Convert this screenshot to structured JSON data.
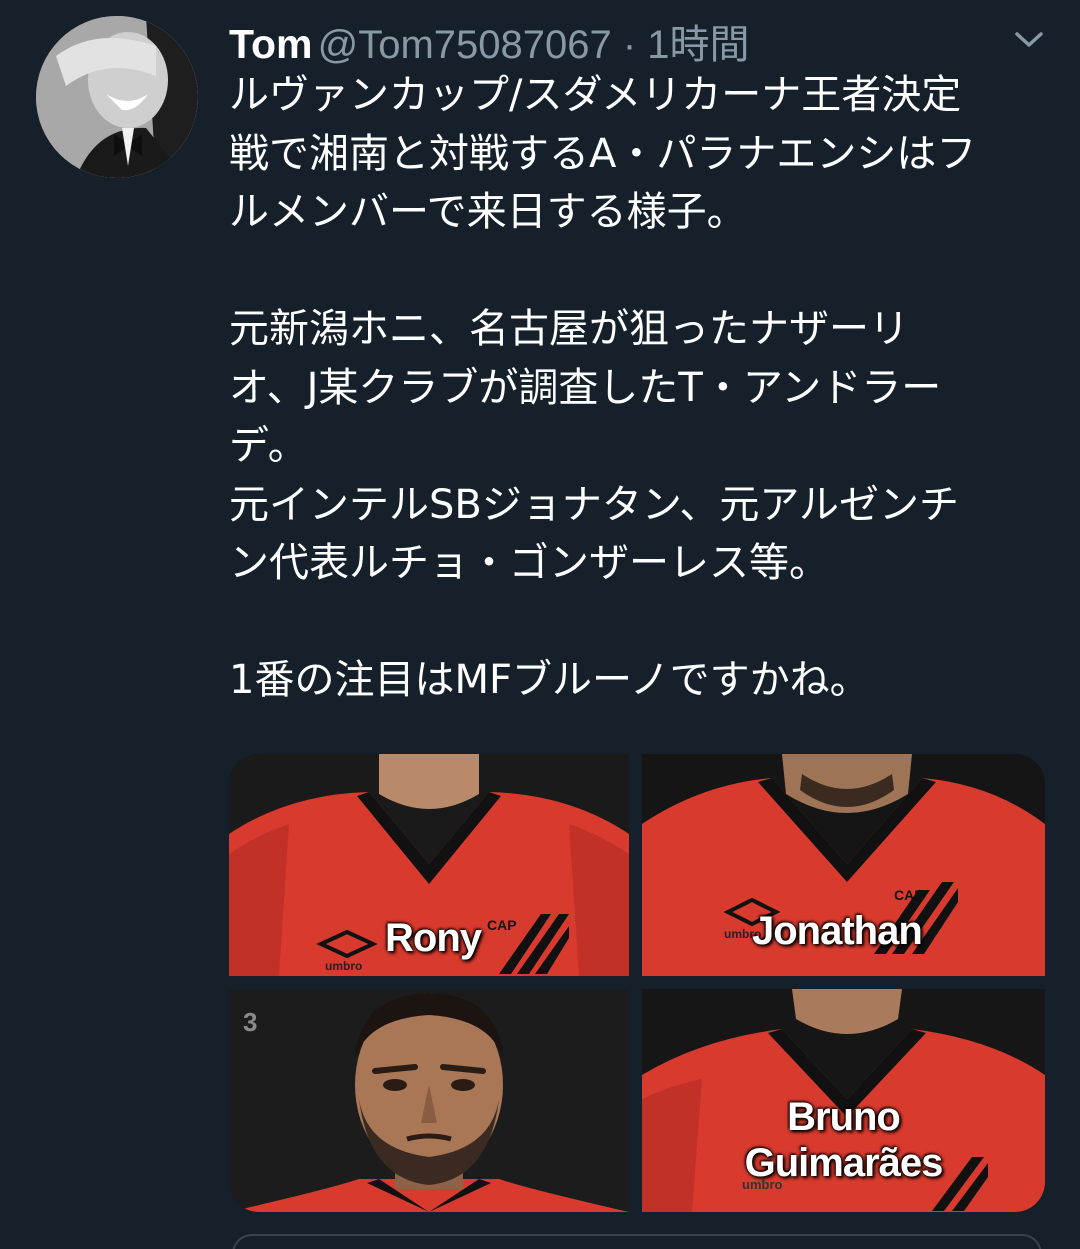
{
  "user": {
    "name": "Tom",
    "handle": "@Tom75087067",
    "separator": "·",
    "time": "1時間",
    "avatar": "avatar-man-bowtie"
  },
  "tweet": {
    "lines": [
      "ルヴァンカップ/スダメリカーナ王者決定",
      "戦で湘南と対戦するA・パラナエンシはフ",
      "ルメンバーで来日する様子。",
      "",
      "元新潟ホニ、名古屋が狙ったナザーリ",
      "オ、J某クラブが調査したT・アンドラー",
      "デ。",
      "元インテルSBジョナタン、元アルゼンチ",
      "ン代表ルチョ・ゴンザーレス等。",
      "",
      "1番の注目はMFブルーノですかね。"
    ]
  },
  "media": [
    {
      "name_lines": [
        "Rony"
      ],
      "brand": "umbro",
      "crest": "CAP"
    },
    {
      "name_lines": [
        "Jonathan"
      ],
      "brand": "umbro",
      "crest": "CAP"
    },
    {
      "number": "3"
    },
    {
      "name_lines": [
        "Bruno",
        "Guimarães"
      ],
      "brand": "umbro"
    }
  ],
  "icons": {
    "caret": "chevron-down-icon"
  },
  "colors": {
    "background": "#15202b",
    "text": "#ffffff",
    "secondary_text": "#8899a6",
    "jersey_red": "#d93a2e",
    "jersey_black": "#111111"
  }
}
